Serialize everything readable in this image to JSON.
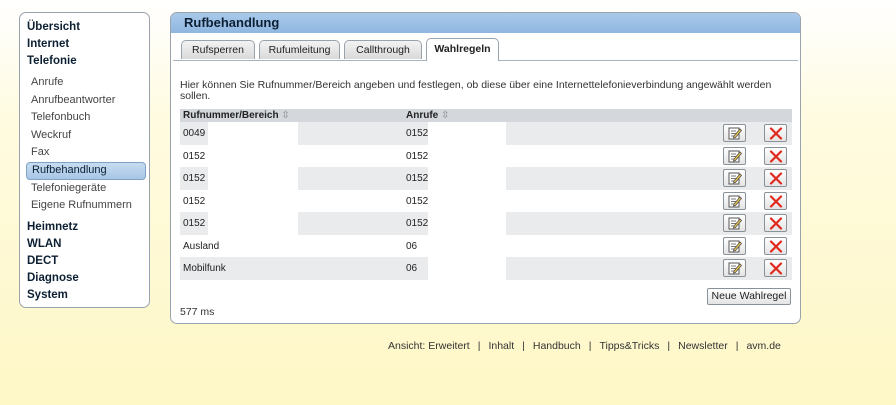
{
  "sidebar": {
    "overview": "Übersicht",
    "internet": "Internet",
    "telefonie": "Telefonie",
    "items": [
      {
        "label": "Anrufe"
      },
      {
        "label": "Anrufbeantworter"
      },
      {
        "label": "Telefonbuch"
      },
      {
        "label": "Weckruf"
      },
      {
        "label": "Fax"
      },
      {
        "label": "Rufbehandlung"
      },
      {
        "label": "Telefoniegeräte"
      },
      {
        "label": "Eigene Rufnummern"
      }
    ],
    "heimnetz": "Heimnetz",
    "wlan": "WLAN",
    "dect": "DECT",
    "diagnose": "Diagnose",
    "system": "System"
  },
  "main": {
    "title": "Rufbehandlung",
    "tabs": [
      {
        "label": "Rufsperren"
      },
      {
        "label": "Rufumleitung"
      },
      {
        "label": "Callthrough"
      },
      {
        "label": "Wahlregeln",
        "active": true
      }
    ],
    "description": "Hier können Sie Rufnummer/Bereich angeben und festlegen, ob diese über eine Internettelefonieverbindung angewählt werden sollen.",
    "table": {
      "headers": [
        "Rufnummer/Bereich",
        "Anrufe"
      ],
      "rows": [
        {
          "range": "0049",
          "calls": "0152"
        },
        {
          "range": "0152",
          "calls": "0152"
        },
        {
          "range": "0152",
          "calls": "0152"
        },
        {
          "range": "0152",
          "calls": "0152"
        },
        {
          "range": "0152",
          "calls": "0152"
        },
        {
          "range": "Ausland",
          "calls": "06"
        },
        {
          "range": "Mobilfunk",
          "calls": "06"
        }
      ]
    },
    "new_rule_button": "Neue Wahlregel",
    "timing": "577 ms"
  },
  "footer": {
    "view": "Ansicht: Erweitert",
    "content": "Inhalt",
    "manual": "Handbuch",
    "tips": "Tipps&Tricks",
    "newsletter": "Newsletter",
    "site": "avm.de"
  },
  "colors": {
    "accent": "#a9c9ea",
    "delete": "#e0281e"
  }
}
